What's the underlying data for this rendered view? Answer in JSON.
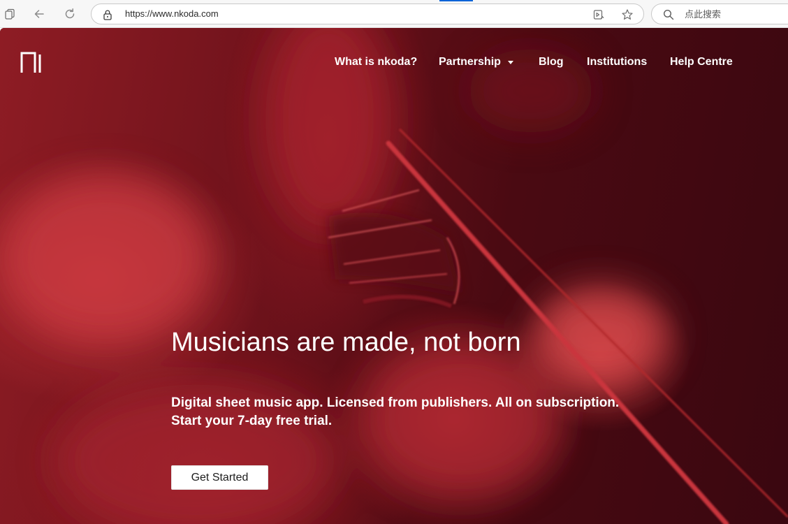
{
  "browser": {
    "url": "https://www.nkoda.com",
    "search_placeholder": "点此搜索",
    "accent_color": "#0b64d8"
  },
  "site": {
    "brand_color": "#6b0f1a",
    "nav": {
      "what_is": "What is nkoda?",
      "partnership": "Partnership",
      "blog": "Blog",
      "institutions": "Institutions",
      "help_centre": "Help Centre"
    },
    "hero": {
      "title": "Musicians are made, not born",
      "subtitle_line1": "Digital sheet music app. Licensed from publishers. All on subscription.",
      "subtitle_line2": "Start your 7-day free trial.",
      "cta_label": "Get Started"
    }
  }
}
